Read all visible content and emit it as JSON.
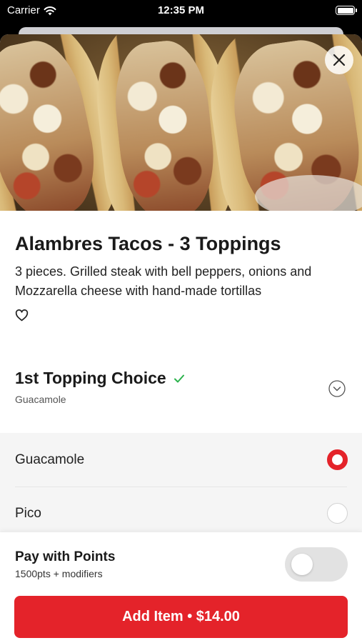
{
  "status_bar": {
    "carrier": "Carrier",
    "time": "12:35 PM",
    "wifi_icon": "wifi-icon",
    "battery_icon": "battery-icon"
  },
  "item": {
    "title": "Alambres Tacos - 3 Toppings",
    "description": "3 pieces. Grilled steak with bell peppers, onions and Mozzarella cheese with hand-made tortillas",
    "favorite_icon": "heart-icon",
    "close_icon": "close-icon"
  },
  "topping_choice": {
    "title": "1st Topping Choice",
    "selected_summary": "Guacamole",
    "check_icon": "checkmark-icon",
    "expand_icon": "chevron-down-icon",
    "options": [
      {
        "label": "Guacamole",
        "selected": true
      },
      {
        "label": "Pico",
        "selected": false
      }
    ]
  },
  "points": {
    "title": "Pay with Points",
    "subtitle": "1500pts + modifiers",
    "enabled": false
  },
  "add_button": {
    "label": "Add Item • $14.00"
  },
  "colors": {
    "accent": "#e4232a",
    "check_green": "#2bb24c"
  }
}
